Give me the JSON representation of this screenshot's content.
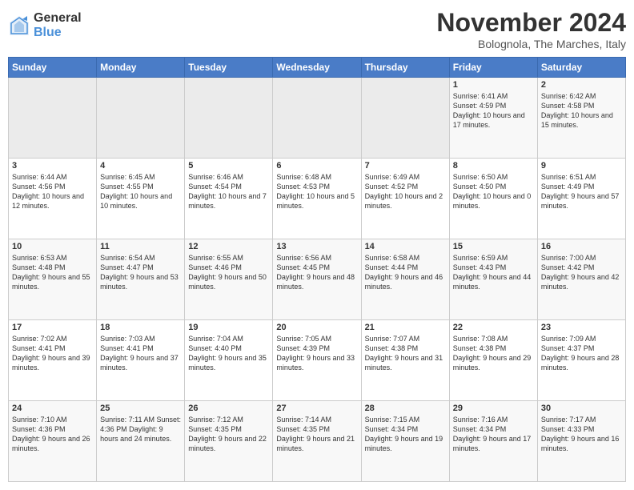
{
  "logo": {
    "general": "General",
    "blue": "Blue"
  },
  "title": "November 2024",
  "location": "Bolognola, The Marches, Italy",
  "days_header": [
    "Sunday",
    "Monday",
    "Tuesday",
    "Wednesday",
    "Thursday",
    "Friday",
    "Saturday"
  ],
  "weeks": [
    [
      {
        "day": "",
        "info": ""
      },
      {
        "day": "",
        "info": ""
      },
      {
        "day": "",
        "info": ""
      },
      {
        "day": "",
        "info": ""
      },
      {
        "day": "",
        "info": ""
      },
      {
        "day": "1",
        "info": "Sunrise: 6:41 AM\nSunset: 4:59 PM\nDaylight: 10 hours and 17 minutes."
      },
      {
        "day": "2",
        "info": "Sunrise: 6:42 AM\nSunset: 4:58 PM\nDaylight: 10 hours and 15 minutes."
      }
    ],
    [
      {
        "day": "3",
        "info": "Sunrise: 6:44 AM\nSunset: 4:56 PM\nDaylight: 10 hours and 12 minutes."
      },
      {
        "day": "4",
        "info": "Sunrise: 6:45 AM\nSunset: 4:55 PM\nDaylight: 10 hours and 10 minutes."
      },
      {
        "day": "5",
        "info": "Sunrise: 6:46 AM\nSunset: 4:54 PM\nDaylight: 10 hours and 7 minutes."
      },
      {
        "day": "6",
        "info": "Sunrise: 6:48 AM\nSunset: 4:53 PM\nDaylight: 10 hours and 5 minutes."
      },
      {
        "day": "7",
        "info": "Sunrise: 6:49 AM\nSunset: 4:52 PM\nDaylight: 10 hours and 2 minutes."
      },
      {
        "day": "8",
        "info": "Sunrise: 6:50 AM\nSunset: 4:50 PM\nDaylight: 10 hours and 0 minutes."
      },
      {
        "day": "9",
        "info": "Sunrise: 6:51 AM\nSunset: 4:49 PM\nDaylight: 9 hours and 57 minutes."
      }
    ],
    [
      {
        "day": "10",
        "info": "Sunrise: 6:53 AM\nSunset: 4:48 PM\nDaylight: 9 hours and 55 minutes."
      },
      {
        "day": "11",
        "info": "Sunrise: 6:54 AM\nSunset: 4:47 PM\nDaylight: 9 hours and 53 minutes."
      },
      {
        "day": "12",
        "info": "Sunrise: 6:55 AM\nSunset: 4:46 PM\nDaylight: 9 hours and 50 minutes."
      },
      {
        "day": "13",
        "info": "Sunrise: 6:56 AM\nSunset: 4:45 PM\nDaylight: 9 hours and 48 minutes."
      },
      {
        "day": "14",
        "info": "Sunrise: 6:58 AM\nSunset: 4:44 PM\nDaylight: 9 hours and 46 minutes."
      },
      {
        "day": "15",
        "info": "Sunrise: 6:59 AM\nSunset: 4:43 PM\nDaylight: 9 hours and 44 minutes."
      },
      {
        "day": "16",
        "info": "Sunrise: 7:00 AM\nSunset: 4:42 PM\nDaylight: 9 hours and 42 minutes."
      }
    ],
    [
      {
        "day": "17",
        "info": "Sunrise: 7:02 AM\nSunset: 4:41 PM\nDaylight: 9 hours and 39 minutes."
      },
      {
        "day": "18",
        "info": "Sunrise: 7:03 AM\nSunset: 4:41 PM\nDaylight: 9 hours and 37 minutes."
      },
      {
        "day": "19",
        "info": "Sunrise: 7:04 AM\nSunset: 4:40 PM\nDaylight: 9 hours and 35 minutes."
      },
      {
        "day": "20",
        "info": "Sunrise: 7:05 AM\nSunset: 4:39 PM\nDaylight: 9 hours and 33 minutes."
      },
      {
        "day": "21",
        "info": "Sunrise: 7:07 AM\nSunset: 4:38 PM\nDaylight: 9 hours and 31 minutes."
      },
      {
        "day": "22",
        "info": "Sunrise: 7:08 AM\nSunset: 4:38 PM\nDaylight: 9 hours and 29 minutes."
      },
      {
        "day": "23",
        "info": "Sunrise: 7:09 AM\nSunset: 4:37 PM\nDaylight: 9 hours and 28 minutes."
      }
    ],
    [
      {
        "day": "24",
        "info": "Sunrise: 7:10 AM\nSunset: 4:36 PM\nDaylight: 9 hours and 26 minutes."
      },
      {
        "day": "25",
        "info": "Sunrise: 7:11 AM\nSunset: 4:36 PM\nDaylight: 9 hours and 24 minutes."
      },
      {
        "day": "26",
        "info": "Sunrise: 7:12 AM\nSunset: 4:35 PM\nDaylight: 9 hours and 22 minutes."
      },
      {
        "day": "27",
        "info": "Sunrise: 7:14 AM\nSunset: 4:35 PM\nDaylight: 9 hours and 21 minutes."
      },
      {
        "day": "28",
        "info": "Sunrise: 7:15 AM\nSunset: 4:34 PM\nDaylight: 9 hours and 19 minutes."
      },
      {
        "day": "29",
        "info": "Sunrise: 7:16 AM\nSunset: 4:34 PM\nDaylight: 9 hours and 17 minutes."
      },
      {
        "day": "30",
        "info": "Sunrise: 7:17 AM\nSunset: 4:33 PM\nDaylight: 9 hours and 16 minutes."
      }
    ]
  ]
}
